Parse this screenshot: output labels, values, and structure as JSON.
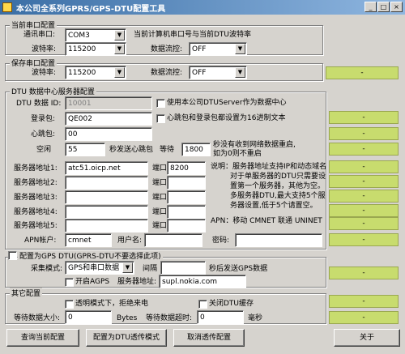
{
  "window": {
    "title": "本公司全系列GPRS/GPS-DTU配置工具",
    "min": "_",
    "max": "□",
    "close": "×"
  },
  "current_port": {
    "title": "当前串口配置",
    "port_label": "通讯串口:",
    "port_value": "COM3",
    "port_note": "当前计算机串口号与当前DTU波特率",
    "baud_label": "波特率:",
    "baud_value": "115200",
    "flow_label": "数据流控:",
    "flow_value": "OFF"
  },
  "save_port": {
    "title": "保存串口配置",
    "baud_label": "波特率:",
    "baud_value": "115200",
    "flow_label": "数据流控:",
    "flow_value": "OFF"
  },
  "dtu_server": {
    "title": "DTU 数据中心服务器配置",
    "dtu_id_label": "DTU 数据 ID:",
    "dtu_id_value": "10001",
    "use_company_server": "使用本公司DTUServer作为数据中心",
    "login_label": "登录包:",
    "login_value": "QE002",
    "hex_option": "心跳包和登录包都设置为16进制文本",
    "heartbeat_label": "心跳包:",
    "heartbeat_value": "00",
    "idle_label": "空闲",
    "idle_value": "55",
    "idle_suffix": "秒发送心跳包",
    "wait_label": "等待",
    "wait_value": "1800",
    "wait_note_1": "秒没有收到网络数据重启,",
    "wait_note_2": "如为0则不重启",
    "servers": [
      {
        "label": "服务器地址1:",
        "value": "atc51.oicp.net",
        "port_label": "端口:",
        "port": "8200"
      },
      {
        "label": "服务器地址2:",
        "value": "",
        "port_label": "端口:",
        "port": ""
      },
      {
        "label": "服务器地址3:",
        "value": "",
        "port_label": "端口:",
        "port": ""
      },
      {
        "label": "服务器地址4:",
        "value": "",
        "port_label": "端口:",
        "port": ""
      },
      {
        "label": "服务器地址5:",
        "value": "",
        "port_label": "端口:",
        "port": ""
      }
    ],
    "note_lines": [
      "说明：服务器地址支持IP和动态域名",
      "对于单服务器的DTU只需要设",
      "置第一个服务器，其他为空。",
      "多服务器DTU,最大支持5个服",
      "务器设置,低于5个请置空。"
    ],
    "apn_note": "APN：移动 CMNET 联通 UNINET",
    "apn_label": "APN帐户:",
    "apn_value": "cmnet",
    "user_label": "用户名:",
    "user_value": "",
    "pass_label": "密码:",
    "pass_value": ""
  },
  "gps": {
    "title": "配置为GPS DTU(GPRS-DTU不要选择此项)",
    "mode_label": "采集模式:",
    "mode_value": "GPS和串口数据",
    "interval_label": "间隔",
    "interval_value": "",
    "interval_suffix": "秒后发送GPS数据",
    "agps_label": "开启AGPS",
    "server_label": "服务器地址:",
    "server_value": "supl.nokia.com"
  },
  "other": {
    "title": "其它配置",
    "transparent_label": "透明模式下，拒绝来电",
    "close_cache_label": "关闭DTU缓存",
    "wait_size_label": "等待数据大小:",
    "wait_size_value": "0",
    "wait_size_unit": "Bytes",
    "wait_timeout_label": "等待数据超时:",
    "wait_timeout_value": "0",
    "wait_timeout_unit": "毫秒"
  },
  "status_mark": "-",
  "buttons": {
    "query": "查询当前配置",
    "config": "配置为DTU透传模式",
    "cancel": "取消透传配置",
    "about": "关于"
  },
  "colors": {
    "titlebar": "#3a6ea5",
    "status": "#c8dc6e",
    "face": "#d6d3ce"
  }
}
